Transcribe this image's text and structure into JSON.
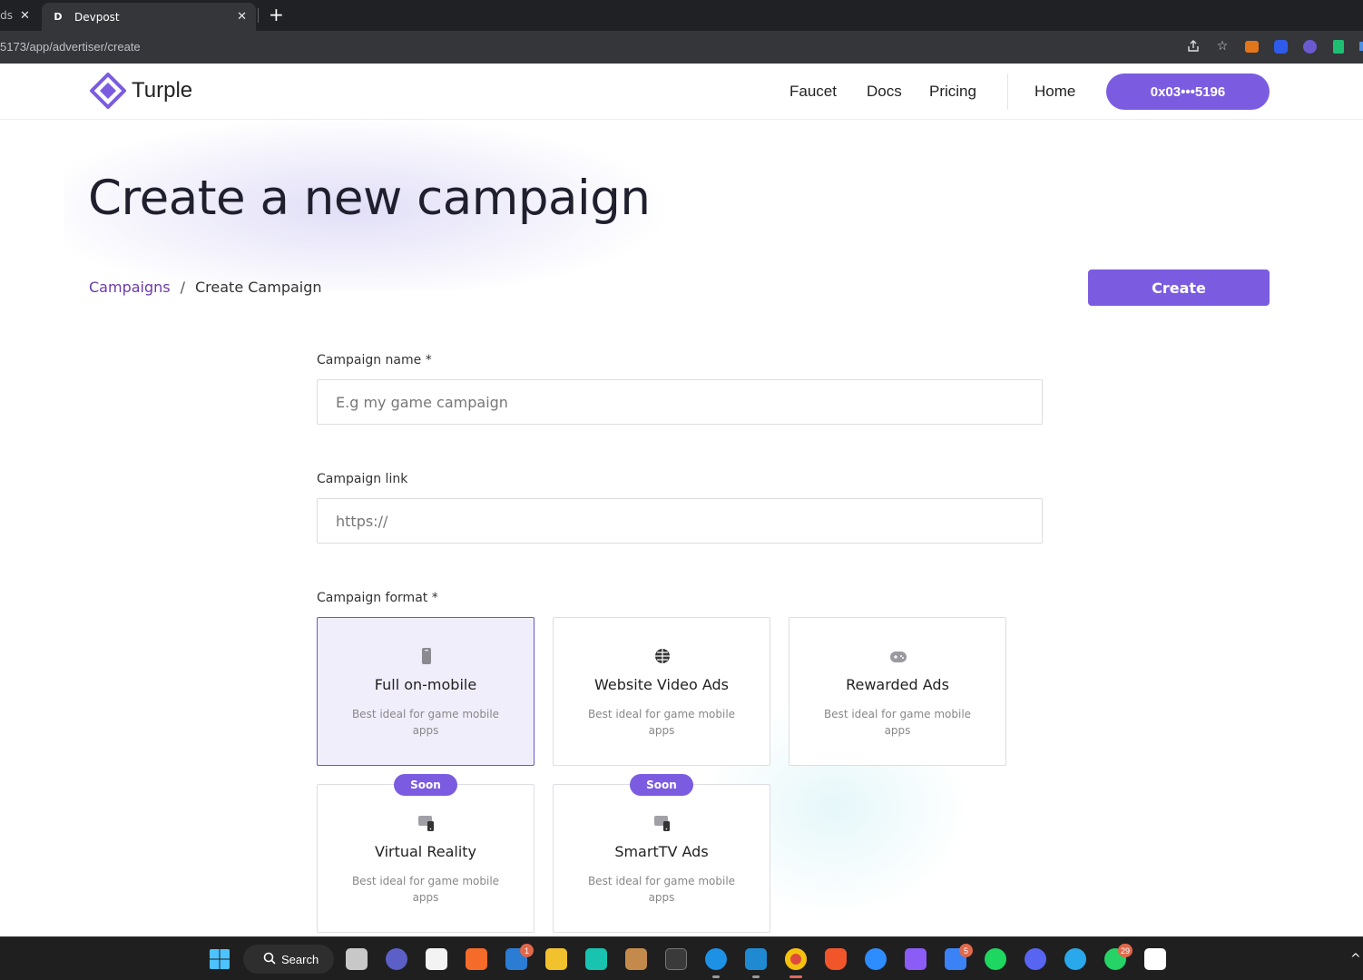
{
  "browser": {
    "prev_tab_title": "Ads",
    "active_tab": {
      "favicon": "D",
      "title": "Devpost"
    },
    "url": "5173/app/advertiser/create"
  },
  "header": {
    "brand": "Turple",
    "nav": [
      "Faucet",
      "Docs",
      "Pricing"
    ],
    "home": "Home",
    "wallet": "0x03•••5196"
  },
  "page": {
    "title": "Create a new campaign",
    "breadcrumb": {
      "link": "Campaigns",
      "separator": "/",
      "current": "Create Campaign"
    },
    "create_button": "Create"
  },
  "form": {
    "name_label": "Campaign name *",
    "name_placeholder": "E.g my game campaign",
    "link_label": "Campaign link",
    "link_placeholder": "https://",
    "format_label": "Campaign format *",
    "formats": [
      {
        "title": "Full on-mobile",
        "desc": "Best ideal for game mobile apps",
        "icon": "mobile-icon",
        "selected": true,
        "badge": ""
      },
      {
        "title": "Website Video Ads",
        "desc": "Best ideal for game mobile apps",
        "icon": "globe-icon",
        "selected": false,
        "badge": ""
      },
      {
        "title": "Rewarded Ads",
        "desc": "Best ideal for game mobile apps",
        "icon": "gamepad-icon",
        "selected": false,
        "badge": ""
      },
      {
        "title": "Virtual Reality",
        "desc": "Best ideal for game mobile apps",
        "icon": "vr-devices-icon",
        "selected": false,
        "badge": "Soon"
      },
      {
        "title": "SmartTV Ads",
        "desc": "Best ideal for game mobile apps",
        "icon": "tv-devices-icon",
        "selected": false,
        "badge": "Soon"
      }
    ]
  },
  "taskbar": {
    "search_label": "Search",
    "mail_badge": "1",
    "todo_badge": "5",
    "whatsapp_badge": "29"
  },
  "colors": {
    "accent": "#7b5ce0",
    "link": "#6b3aa8",
    "selected_bg": "#f1eefc"
  }
}
